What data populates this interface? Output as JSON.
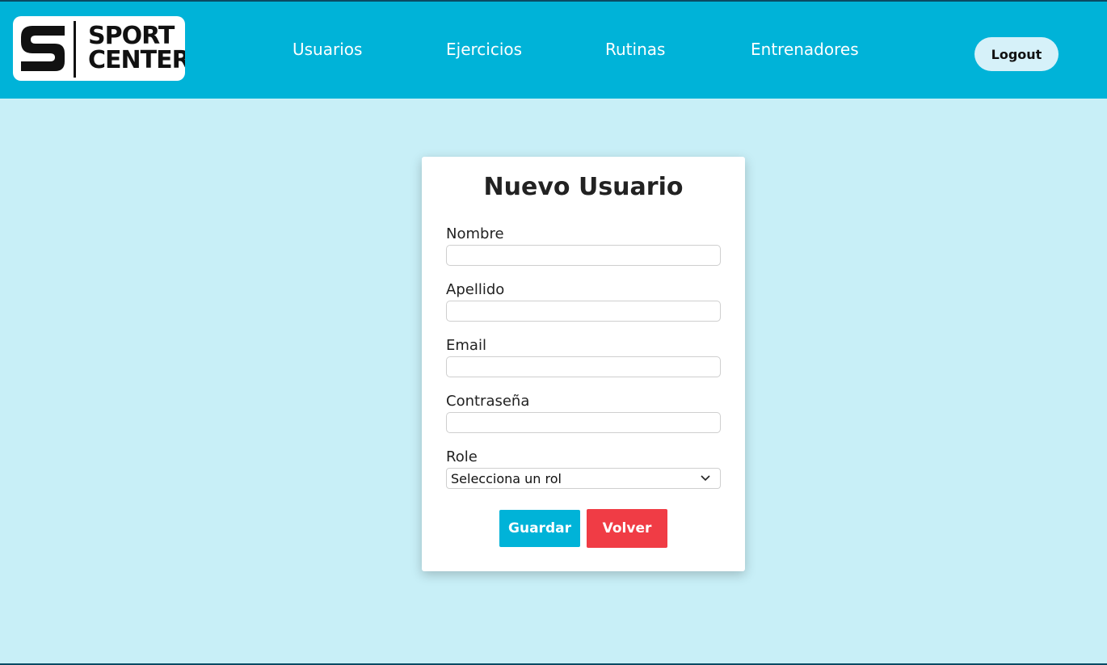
{
  "header": {
    "logo": {
      "line1": "SPORT",
      "line2": "CENTER"
    },
    "nav": [
      {
        "label": "Usuarios"
      },
      {
        "label": "Ejercicios"
      },
      {
        "label": "Rutinas"
      },
      {
        "label": "Entrenadores"
      }
    ],
    "logout_label": "Logout"
  },
  "form": {
    "title": "Nuevo Usuario",
    "fields": [
      {
        "label": "Nombre",
        "value": ""
      },
      {
        "label": "Apellido",
        "value": ""
      },
      {
        "label": "Email",
        "value": ""
      },
      {
        "label": "Contraseña",
        "value": ""
      }
    ],
    "role": {
      "label": "Role",
      "selected": "Selecciona un rol"
    },
    "save_label": "Guardar",
    "back_label": "Volver"
  },
  "colors": {
    "header_bg": "#00b3d8",
    "page_bg": "#c8eff7",
    "primary": "#00b3d8",
    "danger": "#f03c45"
  }
}
